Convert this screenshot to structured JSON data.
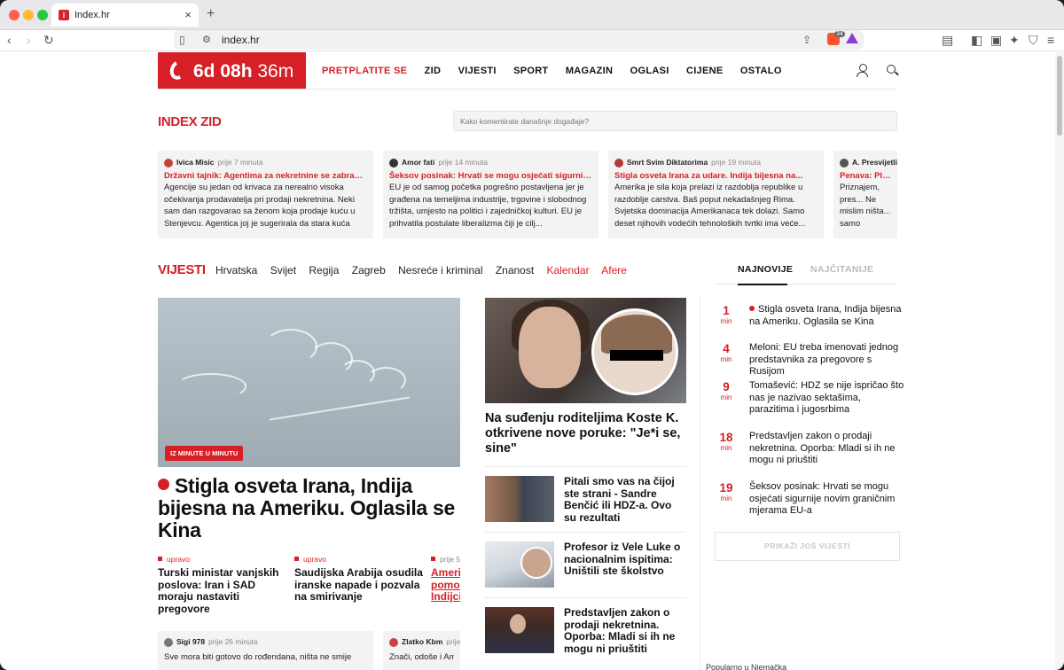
{
  "browser": {
    "tab_title": "Index.hr",
    "url": "index.hr",
    "shield_count": "34"
  },
  "header": {
    "countdown_bold": "6d 08h",
    "countdown_light": "36m",
    "nav": [
      "PRETPLATITE SE",
      "ZID",
      "VIJESTI",
      "SPORT",
      "MAGAZIN",
      "OGLASI",
      "CIJENE",
      "OSTALO"
    ]
  },
  "zid": {
    "title": "INDEX ZID",
    "input_placeholder": "Kako komentirate današnje događaje?",
    "cards": [
      {
        "author": "Ivica Misic",
        "time": "prije 7 minuta",
        "title": "Državni tajnik: Agentima za nekretnine se zabranjuje...",
        "body": "Agencije su jedan od krivaca za nerealno visoka očekivanja prodavatelja pri prodaji nekretnina. Neki sam dan razgovarao sa ženom koja prodaje kuću u Stenjevcu. Agentica joj je sugerirala da stara kuća od...",
        "avatar_color": "#c8433b"
      },
      {
        "author": "Amor fati",
        "time": "prije 14 minuta",
        "title": "Šeksov posinak: Hrvati se mogu osjećati sigurnije...",
        "body": "EU je od samog početka pogrešno postavljena jer je građena na temeljima industrije, trgovine i slobodnog tržišta, umjesto na politici i zajedničkoj kulturi. EU je prihvatila postulate liberalizma čiji je cilj...",
        "avatar_color": "#333333"
      },
      {
        "author": "Smrt Svim Diktatorima",
        "time": "prije 19 minuta",
        "title": "Stigla osveta Irana za udare. Indija bijesna na...",
        "body": "Amerika je sila koja prelazi iz razdoblja republike u razdoblje carstva. Baš poput nekadašnjeg Rima. Svjetska dominacija Amerikanaca tek dolazi. Samo deset njihovih vodećih tehnoloških tvrtki ima veće...",
        "avatar_color": "#b33a3a"
      },
      {
        "author": "A. Presvijetli",
        "time": "",
        "title": "Penava: Plenkov...",
        "body": "Priznajem, pres... Ne mislim ništa... samo razočara...",
        "avatar_color": "#555555"
      }
    ]
  },
  "vijesti": {
    "title": "VIJESTI",
    "subnav": [
      "Hrvatska",
      "Svijet",
      "Regija",
      "Zagreb",
      "Nesreće i kriminal",
      "Znanost"
    ],
    "subnav_red": [
      "Kalendar",
      "Afere"
    ],
    "tabs": [
      "NAJNOVIJE",
      "NAJČITANIJE"
    ]
  },
  "hero": {
    "tag": "IZ MINUTE U MINUTU",
    "title": "Stigla osveta Irana, Indija bijesna na Ameriku. Oglasila se Kina",
    "subs": [
      {
        "label": "upravo",
        "title": "Turski ministar vanjskih poslova: Iran i SAD moraju nastaviti pregovore"
      },
      {
        "label": "upravo",
        "title": "Saudijska Arabija osudila iranske napade i pozvala na smirivanje"
      },
      {
        "label": "prije 5",
        "title": "Ameri... pomor... Indijci..."
      }
    ]
  },
  "bottom_cards": [
    {
      "author": "Sigi 978",
      "time": "prije 26 minuta",
      "body": "Sve mora biti gotovo do rođendana, ništa ne smije"
    },
    {
      "author": "Zlatko Kbm",
      "time": "prije",
      "body": "Znači, odoše i Amer"
    }
  ],
  "middle": {
    "main_title": "Na suđenju roditeljima Koste K. otkrivene nove poruke: \"Je*i se, sine\"",
    "items": [
      "Pitali smo vas na čijoj ste strani - Sandre Benčić ili HDZ-a. Ovo su rezultati",
      "Profesor iz Vele Luke o nacionalnim ispitima: Uništili ste školstvo",
      "Predstavljen zakon o prodaji nekretnina. Oporba: Mladi si ih ne mogu ni priuštiti"
    ]
  },
  "latest": {
    "unit": "min",
    "items": [
      {
        "num": "1",
        "text": "Stigla osveta Irana, Indija bijesna na Ameriku. Oglasila se Kina",
        "live": true
      },
      {
        "num": "4",
        "text": "Meloni: EU treba imenovati jednog predstavnika za pregovore s Rusijom",
        "live": false
      },
      {
        "num": "9",
        "text": "Tomašević: HDZ se nije ispričao što nas je nazivao sektašima, parazitima i jugosrbima",
        "live": false
      },
      {
        "num": "18",
        "text": "Predstavljen zakon o prodaji nekretnina. Oporba: Mladi si ih ne mogu ni priuštiti",
        "live": false
      },
      {
        "num": "19",
        "text": "Šeksov posinak: Hrvati se mogu osjećati sigurnije novim graničnim mjerama EU-a",
        "live": false
      }
    ],
    "more_button": "PRIKAŽI JOŠ VIJESTI",
    "bottom_text": "Popularno u Njemačka"
  }
}
